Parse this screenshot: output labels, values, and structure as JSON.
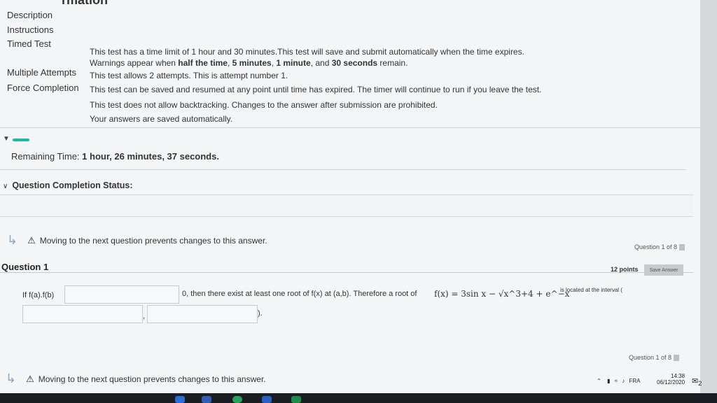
{
  "header": {
    "cut_title": "rmation"
  },
  "info": {
    "labels": [
      "Description",
      "Instructions",
      "Timed Test",
      "Multiple Attempts",
      "Force Completion"
    ],
    "timed_line1": "This test has a time limit of 1 hour and 30 minutes.This test will save and submit automatically when the time expires.",
    "timed_line2_a": "Warnings appear when ",
    "timed_line2_b": "half the time",
    "timed_line2_c": ", ",
    "timed_line2_d": "5 minutes",
    "timed_line2_e": ", ",
    "timed_line2_f": "1 minute",
    "timed_line2_g": ", and ",
    "timed_line2_h": "30 seconds",
    "timed_line2_i": " remain.",
    "multiple": "This test allows 2 attempts. This is attempt number 1.",
    "force": "This test can be saved and resumed at any point until time has expired. The timer will continue to run if you leave the test.",
    "backtrack": "This test does not allow backtracking. Changes to the answer after submission are prohibited.",
    "autosave": "Your answers are saved automatically."
  },
  "timer": {
    "label": "Remaining Time:",
    "value": "1 hour, 26 minutes, 37 seconds.",
    "progress": 0.04
  },
  "completion": {
    "label": "Question Completion Status:"
  },
  "warning": {
    "text": "Moving to the next question prevents changes to this answer."
  },
  "question": {
    "counter": "Question 1 of 8",
    "title": "Question 1",
    "points": "12 points",
    "save_label": "Save Answer",
    "prefix": "If f(a).f(b)",
    "middle": "0, then there exist at least one root of f(x) at (a,b). Therefore  a root of",
    "formula": "f(x) = 3sin x − √x^3+4 + e^−x",
    "suffix": "is located at the interval (",
    "close": ")."
  },
  "tray": {
    "time": "14:38",
    "date": "06/12/2020",
    "lang": "FRA",
    "badge": "2"
  },
  "colors": {
    "accent": "#1db9a4",
    "taskbar": "#1a1d22"
  }
}
